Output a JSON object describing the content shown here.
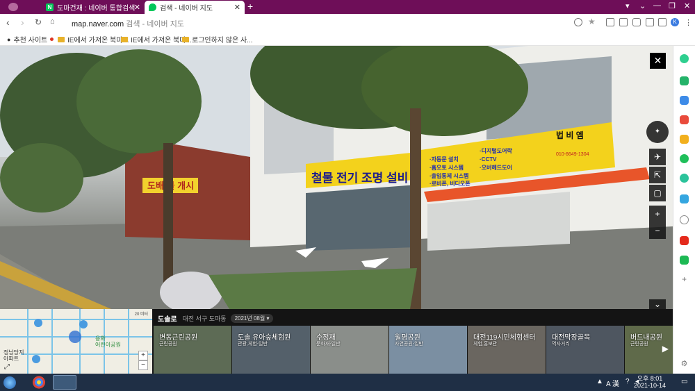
{
  "browser": {
    "tabs": [
      {
        "title": "도마건재 : 네이버 통합검색",
        "favicon": "naver-n-icon",
        "color": "#03c75a",
        "active": false
      },
      {
        "title": "검색 - 네이버 지도",
        "favicon": "naver-map-pin-icon",
        "color": "#03c75a",
        "active": true
      }
    ],
    "new_tab": "+",
    "url_host": "map.naver.com",
    "url_title": "검색 - 네이버 지도"
  },
  "bookmarks": [
    {
      "label": "추천 사이트",
      "icon": "star-icon"
    },
    {
      "label": "IE에서 가져온 북마크",
      "icon": "folder-icon"
    },
    {
      "label": "IE에서 가져온 북마...",
      "icon": "folder-icon"
    },
    {
      "label": "로그인하지 않은 사...",
      "icon": "folder-icon"
    }
  ],
  "streetview": {
    "sign_left": "도배 블 개시",
    "sign_main": "철물 전기 조명 설비",
    "sign_store": "법 비 엠",
    "sign_list_col1": [
      "·자동문 설치",
      "·홈오토 시스템",
      "·출입통제 시스템",
      "·로비폰, 비디오폰"
    ],
    "sign_list_col2": [
      "·디지털도어락",
      "·CCTV",
      "·오버헤드도어"
    ],
    "sign_phone": "010-6649-1304"
  },
  "place": {
    "name": "도솔로",
    "address": "대전 서구 도마동",
    "date": "2021년 08월"
  },
  "minimap": {
    "label_school": "정남당지\n아파트",
    "label_park": "용화\n어린이공원",
    "label_scale": "20 미터"
  },
  "thumbnails": [
    {
      "title": "변동근린공원",
      "category": "근린공원",
      "color": "#5d6b55"
    },
    {
      "title": "도솔 유아숲체험원",
      "category": "관광,체험-일반",
      "color": "#54606a"
    },
    {
      "title": "수정재",
      "category": "문화재-일반",
      "color": "#8a8e8a"
    },
    {
      "title": "월평공원",
      "category": "자연공원-일반",
      "color": "#7b8fa2"
    },
    {
      "title": "대전119시민체험센터",
      "category": "체험,홍보관",
      "color": "#6a6660"
    },
    {
      "title": "대전막장골목",
      "category": "먹자거리",
      "color": "#4e5660"
    },
    {
      "title": "버드내공원",
      "category": "근린공원",
      "color": "#5f6a4a"
    }
  ],
  "taskbar": {
    "time": "오후 8:01",
    "date": "2021-10-14",
    "ime": "A 漢"
  },
  "colors": {
    "tab_bar": "#6e0e58",
    "accent_green": "#03c75a"
  }
}
